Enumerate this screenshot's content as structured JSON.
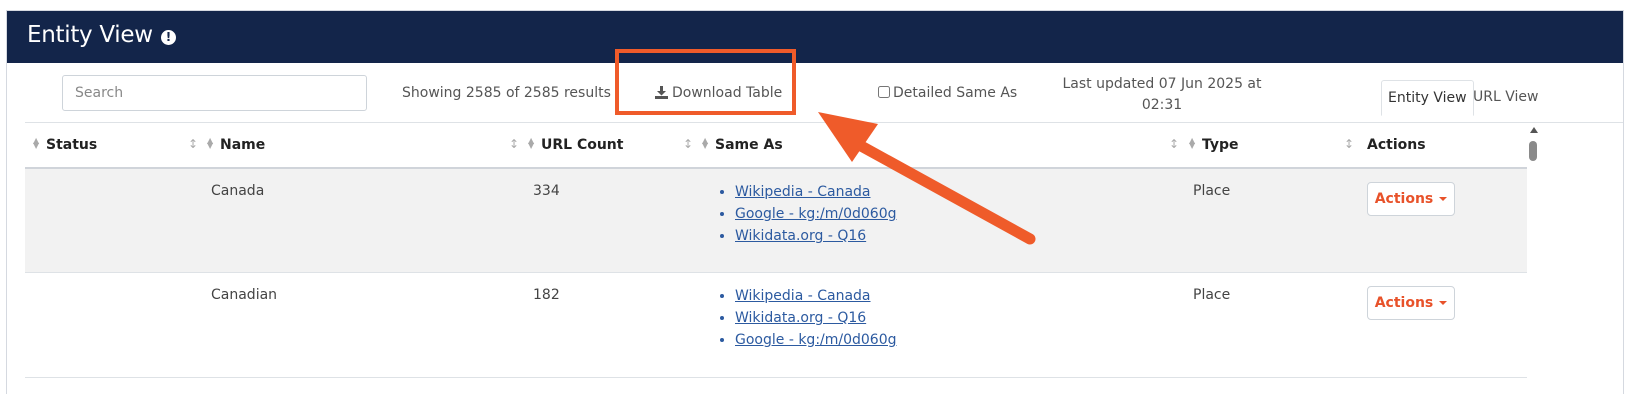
{
  "header": {
    "title": "Entity View",
    "info_icon": "exclamation-circle-icon"
  },
  "toolbar": {
    "search_placeholder": "Search",
    "showing_text": "Showing 2585 of 2585 results",
    "download_label": "Download Table",
    "detailed_same_as_label": "Detailed Same As",
    "last_updated_line1": "Last updated 07 Jun 2025 at",
    "last_updated_line2": "02:31"
  },
  "tabs": [
    {
      "label": "Entity View",
      "active": true
    },
    {
      "label": "URL View",
      "active": false
    }
  ],
  "table": {
    "columns": [
      "Status",
      "Name",
      "URL Count",
      "Same As",
      "Type",
      "Actions"
    ],
    "rows": [
      {
        "status": "",
        "name": "Canada",
        "url_count": "334",
        "same_as": [
          "Wikipedia - Canada",
          "Google - kg:/m/0d060g",
          "Wikidata.org - Q16"
        ],
        "type": "Place",
        "action_label": "Actions"
      },
      {
        "status": "",
        "name": "Canadian",
        "url_count": "182",
        "same_as": [
          "Wikipedia - Canada",
          "Wikidata.org - Q16",
          "Google - kg:/m/0d060g"
        ],
        "type": "Place",
        "action_label": "Actions"
      }
    ]
  },
  "colors": {
    "header_bg": "#13254a",
    "accent": "#ef5b2a",
    "link": "#2c5aa0",
    "action_text": "#e8522a"
  }
}
